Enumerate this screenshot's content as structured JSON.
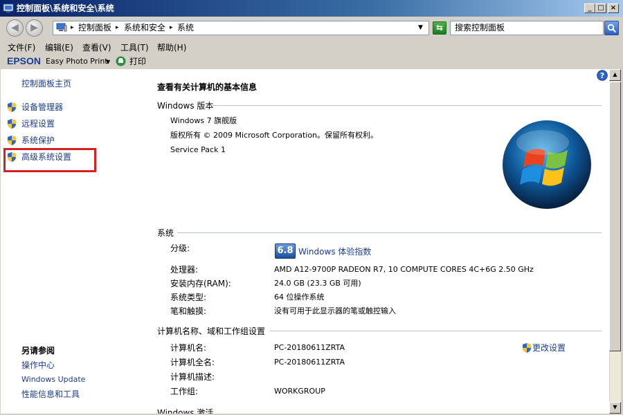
{
  "window": {
    "title": "控制面板\\系统和安全\\系统",
    "min_glyph": "_",
    "max_glyph": "□",
    "close_glyph": "×"
  },
  "address": {
    "crumbs": [
      "控制面板",
      "系统和安全",
      "系统"
    ],
    "search_placeholder": "搜索控制面板"
  },
  "menu": {
    "items": [
      "文件(F)",
      "编辑(E)",
      "查看(V)",
      "工具(T)",
      "帮助(H)"
    ]
  },
  "toolbar": {
    "brand": "EPSON",
    "app": "Easy Photo Print",
    "print": "打印"
  },
  "sidebar": {
    "home": "控制面板主页",
    "items": [
      "设备管理器",
      "远程设置",
      "系统保护",
      "高级系统设置"
    ],
    "see_also_title": "另请参阅",
    "see_also": [
      "操作中心",
      "Windows Update",
      "性能信息和工具"
    ]
  },
  "main": {
    "heading": "查看有关计算机的基本信息",
    "edition_section": "Windows 版本",
    "edition_name": "Windows 7 旗舰版",
    "copyright": "版权所有 © 2009 Microsoft Corporation。保留所有权利。",
    "service_pack": "Service Pack 1",
    "system_section": "系统",
    "rating_label": "分级:",
    "rating_score": "6.8",
    "rating_link": "Windows 体验指数",
    "system_rows": [
      {
        "label": "处理器:",
        "value": "AMD A12-9700P RADEON R7, 10 COMPUTE CORES 4C+6G   2.50 GHz"
      },
      {
        "label": "安装内存(RAM):",
        "value": "24.0 GB (23.3 GB 可用)"
      },
      {
        "label": "系统类型:",
        "value": "64 位操作系统"
      },
      {
        "label": "笔和触摸:",
        "value": "没有可用于此显示器的笔或触控输入"
      }
    ],
    "computer_section": "计算机名称、域和工作组设置",
    "computer_rows": [
      {
        "label": "计算机名:",
        "value": "PC-20180611ZRTA"
      },
      {
        "label": "计算机全名:",
        "value": "PC-20180611ZRTA"
      },
      {
        "label": "计算机描述:",
        "value": ""
      },
      {
        "label": "工作组:",
        "value": "WORKGROUP"
      }
    ],
    "change_settings": "更改设置",
    "activation_section": "Windows 激活"
  },
  "colors": {
    "link": "#1b3d8f",
    "highlight_border": "#d42020",
    "titlebar_start": "#0a246a"
  }
}
